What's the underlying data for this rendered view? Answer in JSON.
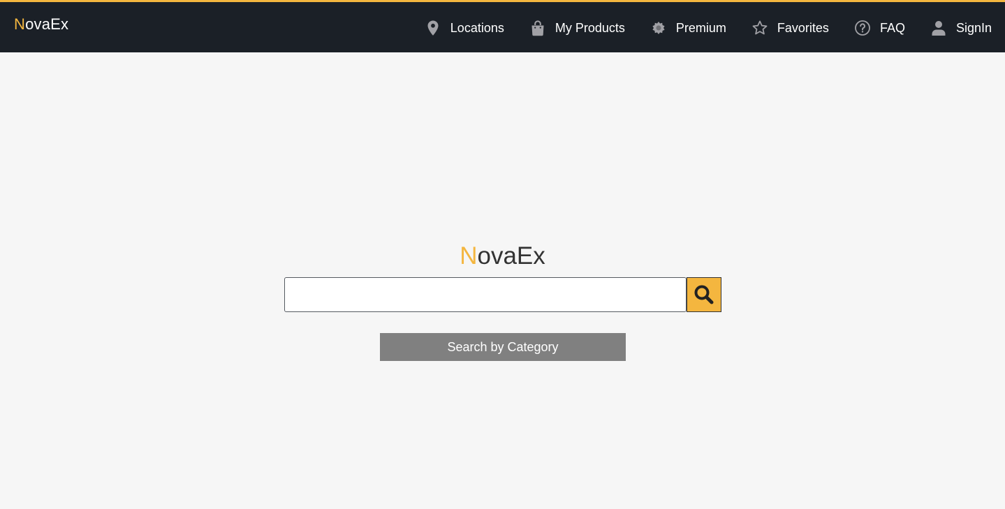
{
  "header": {
    "brand_first": "N",
    "brand_rest": "ovaEx",
    "nav": [
      {
        "label": "Locations",
        "icon": "map-pin-icon"
      },
      {
        "label": "My Products",
        "icon": "shopping-bag-icon"
      },
      {
        "label": "Premium",
        "icon": "premium-badge-icon"
      },
      {
        "label": "Favorites",
        "icon": "star-icon"
      },
      {
        "label": "FAQ",
        "icon": "question-circle-icon"
      },
      {
        "label": "SignIn",
        "icon": "user-icon"
      }
    ]
  },
  "hero": {
    "title_first": "N",
    "title_rest": "ovaEx",
    "search": {
      "value": "",
      "placeholder": "",
      "button_icon": "search-icon"
    },
    "category_button": "Search by Category"
  },
  "colors": {
    "accent": "#f4b63f",
    "topbar": "#1b2027",
    "background": "#f6f6f6",
    "category_button": "#808080"
  }
}
